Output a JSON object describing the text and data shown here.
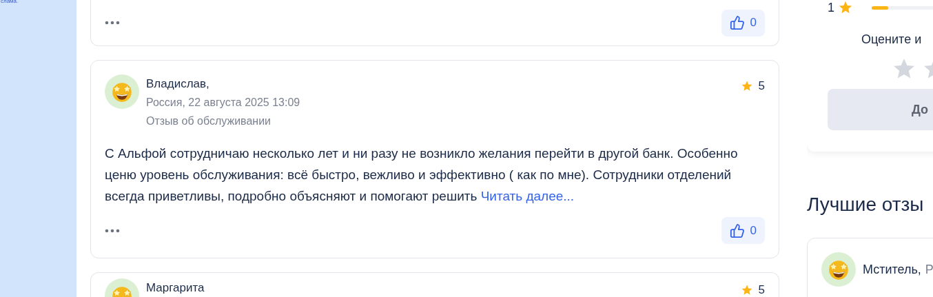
{
  "sidebar": {
    "text": "слама."
  },
  "reviews": [
    {
      "kind": "tail",
      "likes": "0"
    },
    {
      "kind": "full",
      "author": "Владислав,",
      "meta": "Россия, 22 августа 2025 13:09",
      "category": "Отзыв об обслуживании",
      "rating": "5",
      "text": "С Альфой сотрудничаю несколько лет и ни разу не возникло желания перейти в другой банк. Особенно ценю уровень обслуживания: всё быстро, вежливо и эффективно ( как по мне). Сотрудники отделений всегда приветливы, подробно объясняют и помогают решить",
      "read_more": "Читать далее...",
      "likes": "0"
    },
    {
      "kind": "head",
      "author": "Маргарита",
      "rating": "5"
    }
  ],
  "rating_panel": {
    "distribution": [
      {
        "label": "1",
        "level": 0.12
      }
    ],
    "prompt": "Оцените и",
    "button": "До"
  },
  "best_reviews": {
    "title": "Лучшие отзы",
    "items": [
      {
        "author": "Мститель,",
        "location": "Р"
      }
    ]
  }
}
